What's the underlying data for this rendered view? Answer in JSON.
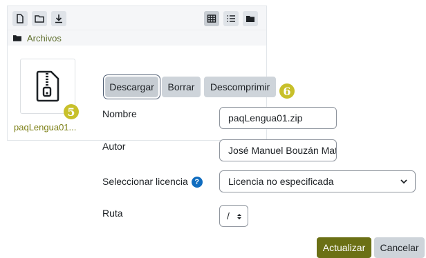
{
  "filemanager": {
    "breadcrumb": "Archivos",
    "file_name": "paqLengua01...",
    "badge_file": "5"
  },
  "details": {
    "buttons": {
      "download": "Descargar",
      "delete": "Borrar",
      "unzip": "Descomprimir"
    },
    "badge_buttons": "6",
    "name_label": "Nombre",
    "name_value": "paqLengua01.zip",
    "author_label": "Autor",
    "author_value": "José Manuel Bouzán Mat",
    "license_label": "Seleccionar licencia",
    "license_value": "Licencia no especificada",
    "path_label": "Ruta",
    "path_value": "/",
    "update_label": "Actualizar",
    "cancel_label": "Cancelar"
  },
  "colors": {
    "accent_olive": "#6b7015",
    "badge_yellow": "#c8c02a",
    "help_blue": "#0f6cbf"
  }
}
